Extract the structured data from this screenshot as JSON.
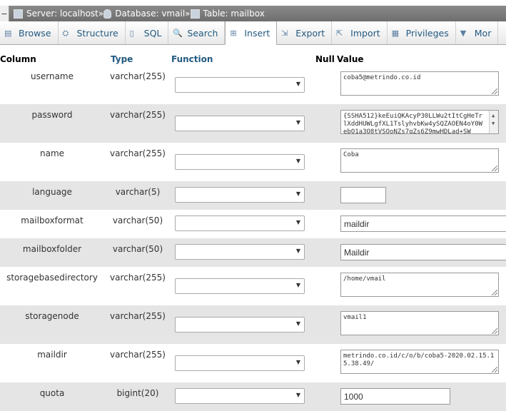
{
  "breadcrumb": {
    "collapse": "−",
    "server": "Server: localhost",
    "database": "Database: vmail",
    "table": "Table: mailbox",
    "sep": "»"
  },
  "tabs": [
    {
      "label": "Browse",
      "icon": "browse-icon"
    },
    {
      "label": "Structure",
      "icon": "structure-icon"
    },
    {
      "label": "SQL",
      "icon": "sql-icon"
    },
    {
      "label": "Search",
      "icon": "search-icon"
    },
    {
      "label": "Insert",
      "icon": "insert-icon",
      "active": true
    },
    {
      "label": "Export",
      "icon": "export-icon"
    },
    {
      "label": "Import",
      "icon": "import-icon"
    },
    {
      "label": "Privileges",
      "icon": "privileges-icon"
    },
    {
      "label": "Mor",
      "icon": "chevron-down-icon"
    }
  ],
  "header": {
    "column": "Column",
    "type": "Type",
    "function": "Function",
    "null": "Null",
    "value": "Value"
  },
  "rows": [
    {
      "name": "username",
      "type": "varchar(255)",
      "value": "coba5@metrindo.co.id",
      "kind": "textarea"
    },
    {
      "name": "password",
      "type": "varchar(255)",
      "value": "{SSHA512}keEuiQKAcyP30LLWu2tItCgHeTrlXddHUWLgfXL1TslyhvbKw4ySQZAOEN4oY0WebO1a3O8tVSOoNZs7qZs6Z9mwHDLad+SW",
      "kind": "textarea"
    },
    {
      "name": "name",
      "type": "varchar(255)",
      "value": "Coba",
      "kind": "textarea"
    },
    {
      "name": "language",
      "type": "varchar(5)",
      "value": "",
      "kind": "input"
    },
    {
      "name": "mailboxformat",
      "type": "varchar(50)",
      "value": "maildir",
      "kind": "input"
    },
    {
      "name": "mailboxfolder",
      "type": "varchar(50)",
      "value": "Maildir",
      "kind": "input"
    },
    {
      "name": "storagebasedirectory",
      "type": "varchar(255)",
      "value": "/home/vmail",
      "kind": "textarea"
    },
    {
      "name": "storagenode",
      "type": "varchar(255)",
      "value": "vmail1",
      "kind": "textarea"
    },
    {
      "name": "maildir",
      "type": "varchar(255)",
      "value": "metrindo.co.id/c/o/b/coba5-2020.02.15.15.38.49/",
      "kind": "textarea"
    },
    {
      "name": "quota",
      "type": "bigint(20)",
      "value": "1000",
      "kind": "input"
    }
  ],
  "colors": {
    "link": "#235a81",
    "rowAlt": "#e5e5e5"
  }
}
